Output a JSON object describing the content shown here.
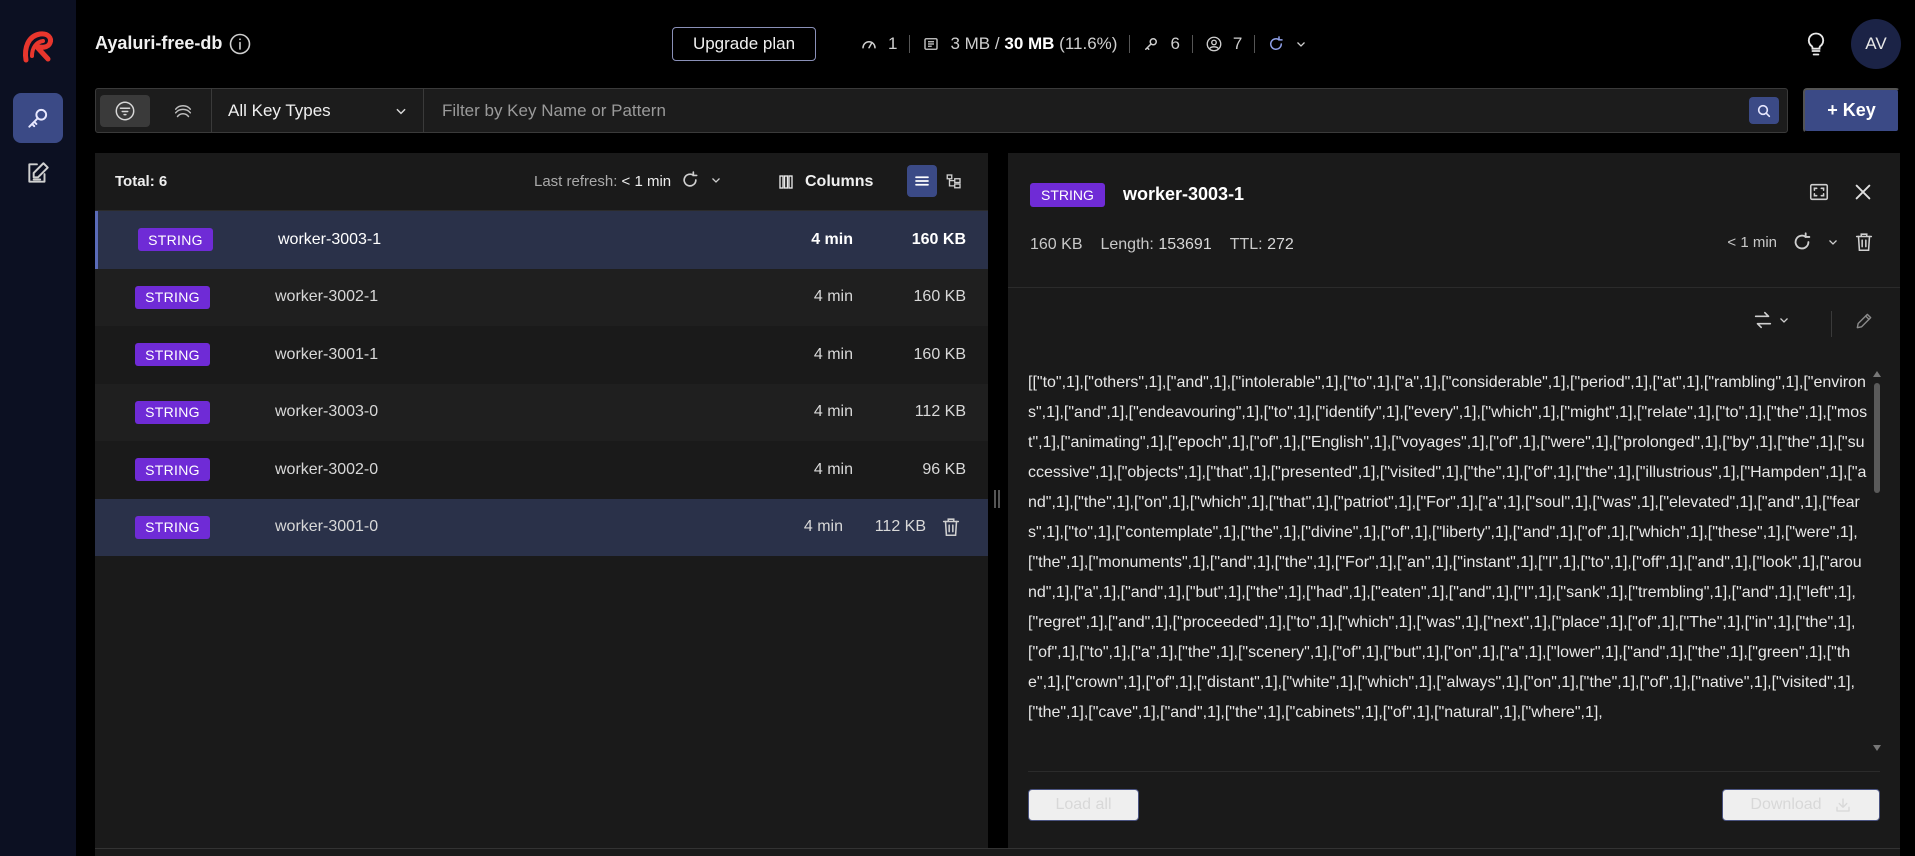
{
  "app": {
    "db_name": "Ayaluri-free-db",
    "upgrade_label": "Upgrade plan",
    "stats": {
      "connections": "1",
      "memory_used": "3 MB",
      "memory_sep": "/",
      "memory_total": "30 MB",
      "memory_pct": "(11.6%)",
      "keys": "6",
      "clients": "7"
    },
    "avatar_initials": "AV",
    "accent_color": "#3b4a86",
    "badge_color": "#6f2bd6"
  },
  "filter": {
    "key_type": "All Key Types",
    "placeholder": "Filter by Key Name or Pattern",
    "add_key_label": "+ Key"
  },
  "list": {
    "total_label": "Total: 6",
    "last_refresh_label": "Last refresh:",
    "last_refresh_value": "< 1 min",
    "columns_label": "Columns",
    "rows": [
      {
        "type": "STRING",
        "name": "worker-3003-1",
        "ttl": "4 min",
        "size": "160 KB"
      },
      {
        "type": "STRING",
        "name": "worker-3002-1",
        "ttl": "4 min",
        "size": "160 KB"
      },
      {
        "type": "STRING",
        "name": "worker-3001-1",
        "ttl": "4 min",
        "size": "160 KB"
      },
      {
        "type": "STRING",
        "name": "worker-3003-0",
        "ttl": "4 min",
        "size": "112 KB"
      },
      {
        "type": "STRING",
        "name": "worker-3002-0",
        "ttl": "4 min",
        "size": "96 KB"
      },
      {
        "type": "STRING",
        "name": "worker-3001-0",
        "ttl": "4 min",
        "size": "112 KB"
      }
    ]
  },
  "detail": {
    "type": "STRING",
    "key_name": "worker-3003-1",
    "size": "160 KB",
    "length_label": "Length:",
    "length_value": "153691",
    "ttl_label": "TTL:",
    "ttl_value": "272",
    "refresh_value": "< 1 min",
    "content": "[[\"to\",1],[\"others\",1],[\"and\",1],[\"intolerable\",1],[\"to\",1],[\"a\",1],[\"considerable\",1],[\"period\",1],[\"at\",1],[\"rambling\",1],[\"environs\",1],[\"and\",1],[\"endeavouring\",1],[\"to\",1],[\"identify\",1],[\"every\",1],[\"which\",1],[\"might\",1],[\"relate\",1],[\"to\",1],[\"the\",1],[\"most\",1],[\"animating\",1],[\"epoch\",1],[\"of\",1],[\"English\",1],[\"voyages\",1],[\"of\",1],[\"were\",1],[\"prolonged\",1],[\"by\",1],[\"the\",1],[\"successive\",1],[\"objects\",1],[\"that\",1],[\"presented\",1],[\"visited\",1],[\"the\",1],[\"of\",1],[\"the\",1],[\"illustrious\",1],[\"Hampden\",1],[\"and\",1],[\"the\",1],[\"on\",1],[\"which\",1],[\"that\",1],[\"patriot\",1],[\"For\",1],[\"a\",1],[\"soul\",1],[\"was\",1],[\"elevated\",1],[\"and\",1],[\"fears\",1],[\"to\",1],[\"contemplate\",1],[\"the\",1],[\"divine\",1],[\"of\",1],[\"liberty\",1],[\"and\",1],[\"of\",1],[\"which\",1],[\"these\",1],[\"were\",1],[\"the\",1],[\"monuments\",1],[\"and\",1],[\"the\",1],[\"For\",1],[\"an\",1],[\"instant\",1],[\"I\",1],[\"to\",1],[\"off\",1],[\"and\",1],[\"look\",1],[\"around\",1],[\"a\",1],[\"and\",1],[\"but\",1],[\"the\",1],[\"had\",1],[\"eaten\",1],[\"and\",1],[\"I\",1],[\"sank\",1],[\"trembling\",1],[\"and\",1],[\"left\",1],[\"regret\",1],[\"and\",1],[\"proceeded\",1],[\"to\",1],[\"which\",1],[\"was\",1],[\"next\",1],[\"place\",1],[\"of\",1],[\"The\",1],[\"in\",1],[\"the\",1],[\"of\",1],[\"to\",1],[\"a\",1],[\"the\",1],[\"scenery\",1],[\"of\",1],[\"but\",1],[\"on\",1],[\"a\",1],[\"lower\",1],[\"and\",1],[\"the\",1],[\"green\",1],[\"the\",1],[\"crown\",1],[\"of\",1],[\"distant\",1],[\"white\",1],[\"which\",1],[\"always\",1],[\"on\",1],[\"the\",1],[\"of\",1],[\"native\",1],[\"visited\",1],[\"the\",1],[\"cave\",1],[\"and\",1],[\"the\",1],[\"cabinets\",1],[\"of\",1],[\"natural\",1],[\"where\",1],",
    "load_all_label": "Load all",
    "download_label": "Download"
  }
}
